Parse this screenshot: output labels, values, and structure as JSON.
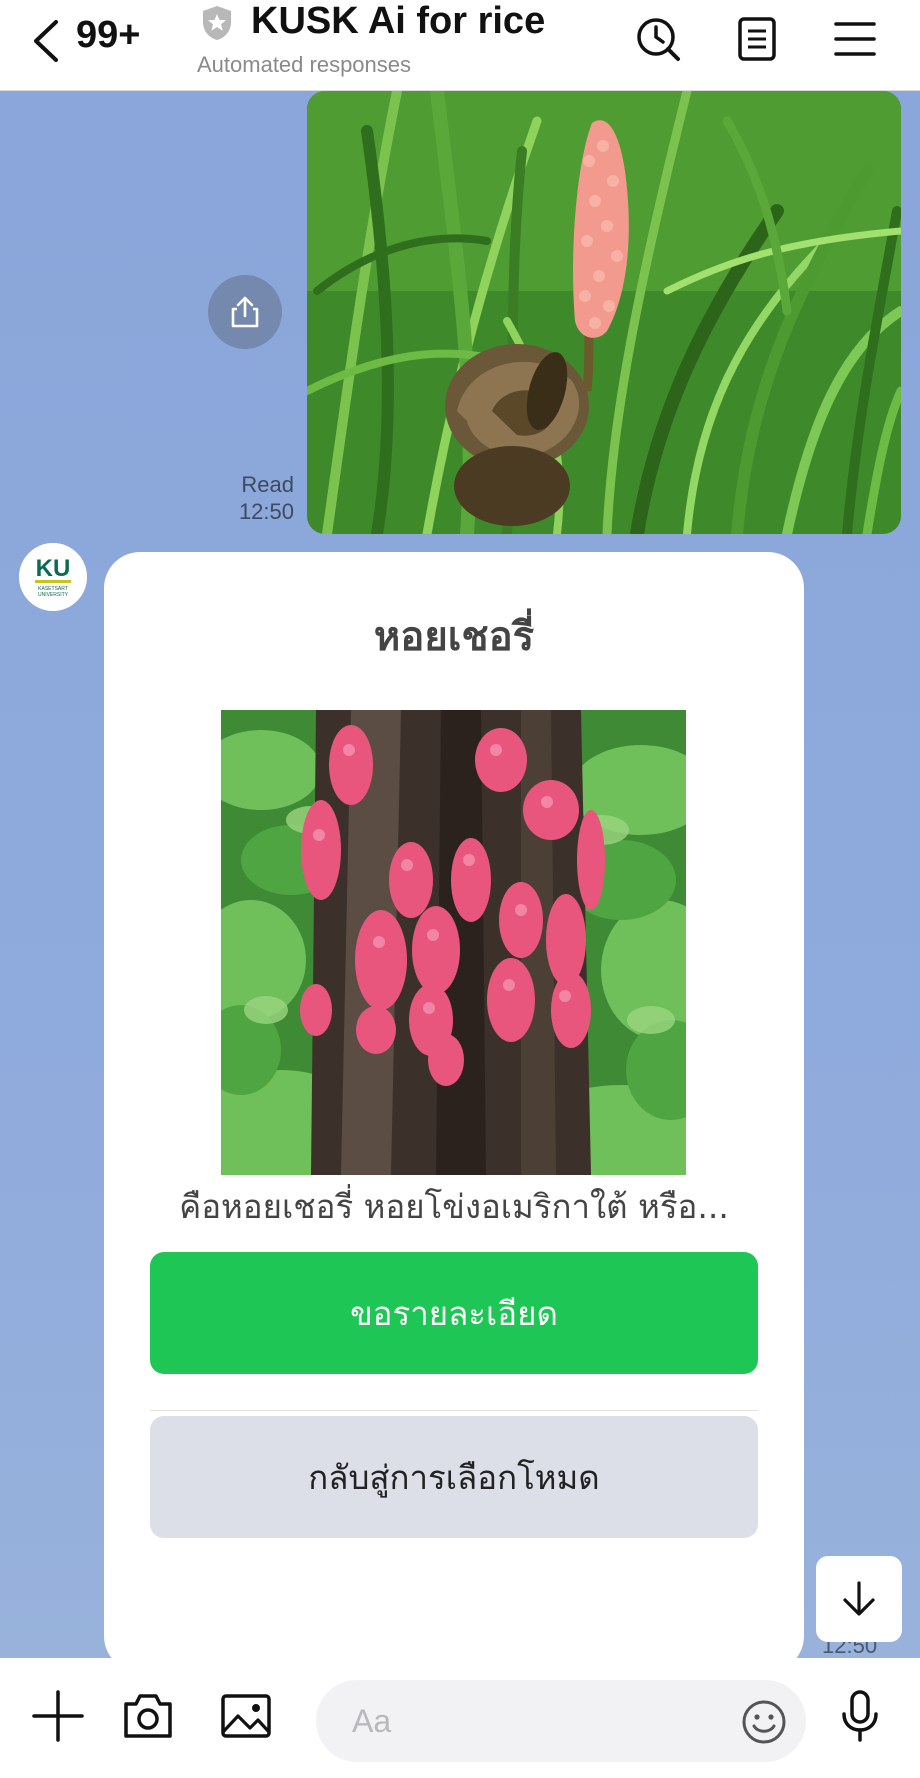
{
  "header": {
    "back_count": "99+",
    "title": "KUSK Ai for rice",
    "subtitle": "Automated responses"
  },
  "messages": {
    "sent": {
      "status": "Read",
      "time": "12:50"
    },
    "card": {
      "avatar_text": "KU",
      "avatar_sub": "KASETSART UNIVERSITY",
      "title": "หอยเชอรี่",
      "text": "คือหอยเชอรี่ หอยโข่งอเมริกาใต้ หรือ...",
      "primary_button": "ขอรายละเอียด",
      "secondary_button": "กลับสู่การเลือกโหมด",
      "time": "12:50"
    }
  },
  "input": {
    "placeholder": "Aa"
  },
  "colors": {
    "accent_green": "#1ec755",
    "chat_background": "#8eaadb",
    "secondary_button": "#dcdfe8"
  },
  "icons": [
    "chevron-left-icon",
    "shield-icon",
    "clock-icon",
    "notes-icon",
    "menu-icon",
    "share-icon",
    "arrow-down-icon",
    "plus-icon",
    "camera-icon",
    "image-icon",
    "emoji-icon",
    "mic-icon"
  ]
}
